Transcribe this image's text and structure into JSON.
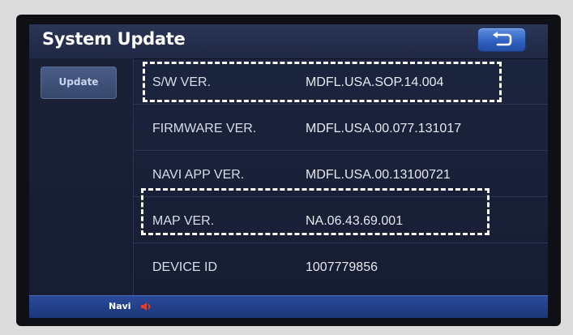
{
  "header": {
    "title": "System Update",
    "back_icon": "back-arrow-icon"
  },
  "sidebar": {
    "items": [
      {
        "label": "Update",
        "active": true
      }
    ]
  },
  "info_rows": [
    {
      "label": "S/W VER.",
      "value": "MDFL.USA.SOP.14.004",
      "highlighted": true
    },
    {
      "label": "FIRMWARE VER.",
      "value": "MDFL.USA.00.077.131017",
      "highlighted": false
    },
    {
      "label": "NAVI APP VER.",
      "value": "MDFL.USA.00.13100721",
      "highlighted": false
    },
    {
      "label": "MAP VER.",
      "value": "NA.06.43.69.001",
      "highlighted": true
    },
    {
      "label": "DEVICE ID",
      "value": "1007779856",
      "highlighted": false
    }
  ],
  "footer": {
    "navi_label": "Navi",
    "navi_icon": "speaker-icon"
  },
  "colors": {
    "screen_background": "#1a223a",
    "accent_blue": "#2c5fbf",
    "highlight": "#ffffff",
    "speaker_icon": "#e0402a"
  }
}
